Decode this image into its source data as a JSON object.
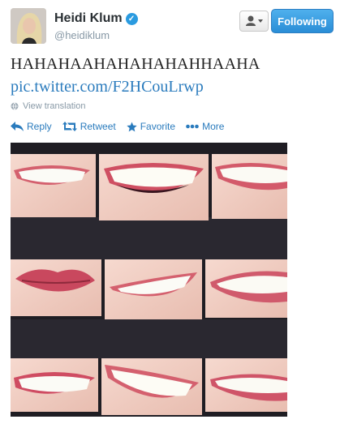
{
  "user": {
    "name": "Heidi Klum",
    "handle": "@heidiklum",
    "verified_icon": "verified-check-icon"
  },
  "buttons": {
    "follow_label": "Following",
    "user_menu_icon": "user-dropdown-icon"
  },
  "tweet": {
    "text": "HAHAHAAHAHAHAHAHHAAHA",
    "link": "pic.twitter.com/F2HCouLrwp",
    "translate_label": "View translation"
  },
  "actions": {
    "reply": "Reply",
    "retweet": "Retweet",
    "favorite": "Favorite",
    "more": "More"
  },
  "colors": {
    "link": "#2a7bbd",
    "follow_button": "#2a8dd6",
    "verified": "#2a9be0",
    "muted": "#8899a6"
  }
}
